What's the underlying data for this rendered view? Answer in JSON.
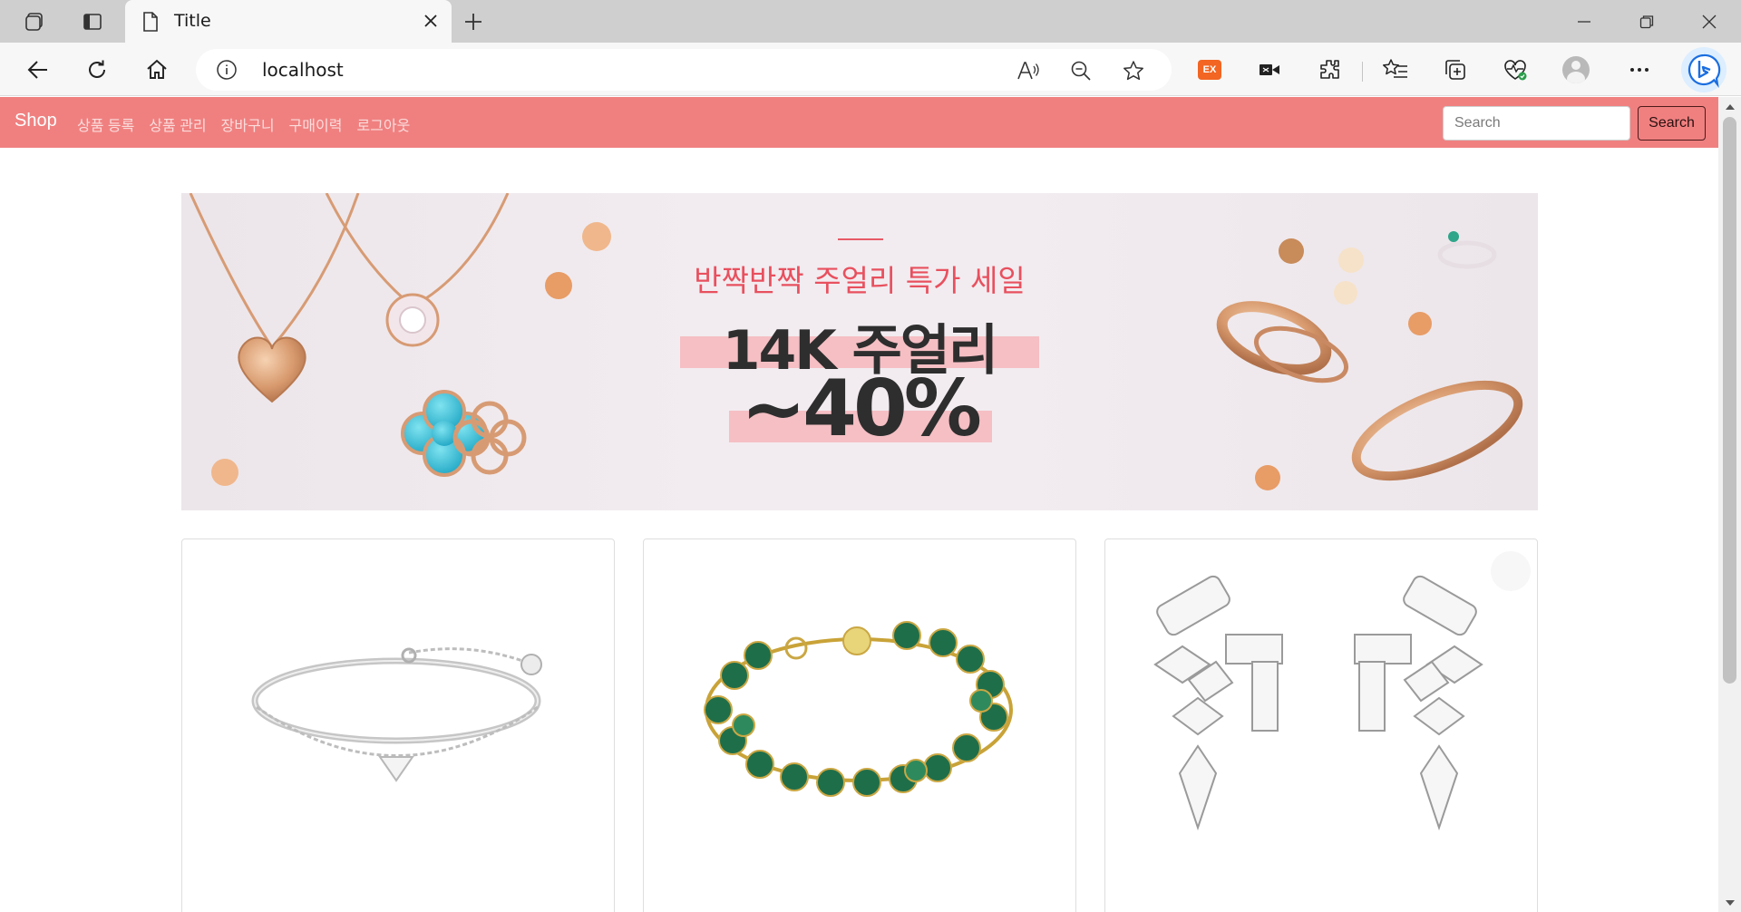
{
  "browser": {
    "tab_title": "Title",
    "address": "localhost",
    "extension_badge": "EX",
    "icons": [
      "workspaces-icon",
      "tab-actions-icon",
      "page-icon",
      "close-icon",
      "new-tab-icon",
      "minimize-icon",
      "restore-icon",
      "window-close-icon",
      "back-icon",
      "refresh-icon",
      "home-icon",
      "info-icon",
      "read-aloud-icon",
      "zoom-out-icon",
      "favorite-star-icon",
      "media-icon",
      "extensions-icon",
      "favorites-icon",
      "collections-icon",
      "health-icon",
      "profile-icon",
      "more-icon",
      "bing-copilot-icon"
    ]
  },
  "navbar": {
    "brand": "Shop",
    "links": [
      "상품 등록",
      "상품 관리",
      "장바구니",
      "구매이력",
      "로그아웃"
    ],
    "search_placeholder": "Search",
    "search_button": "Search",
    "color": "#f08080"
  },
  "banner": {
    "subtitle": "반짝반짝 주얼리 특가 세일",
    "headline": "14K 주얼리",
    "discount": "~40%",
    "accent": "#e8505e"
  },
  "products": [
    {
      "image": "silver-bangle-bracelet-image"
    },
    {
      "image": "green-clover-bracelet-image"
    },
    {
      "image": "crystal-drop-earrings-image"
    }
  ]
}
